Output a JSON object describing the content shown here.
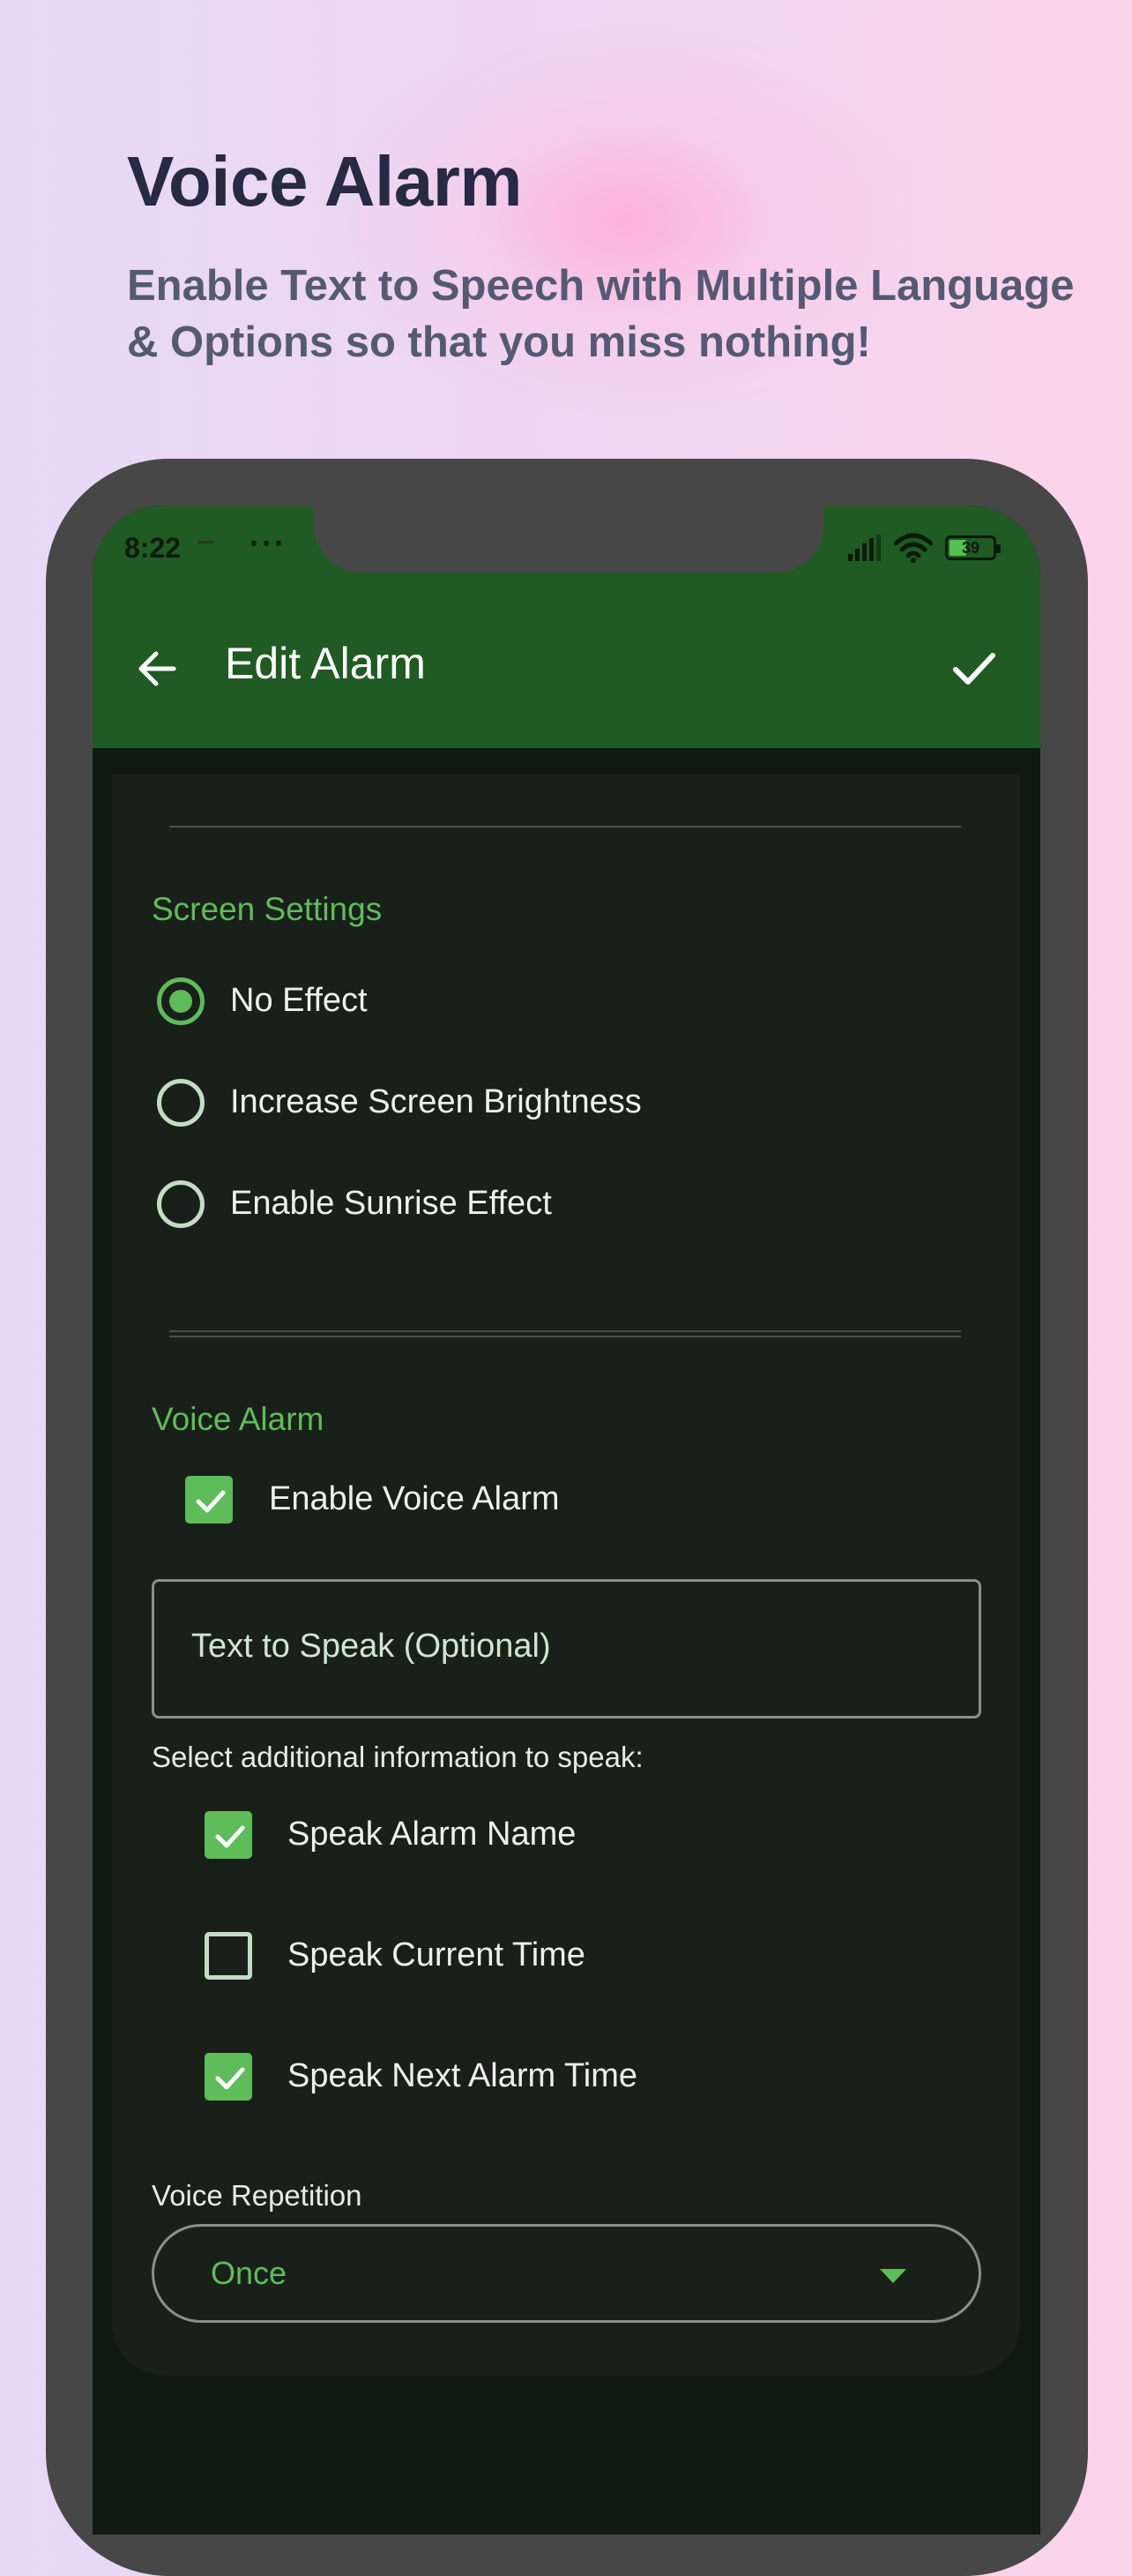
{
  "promo": {
    "title": "Voice Alarm",
    "subtitle": "Enable Text to Speech with Multiple Language & Options so that you miss nothing!"
  },
  "status_bar": {
    "time": "8:22",
    "overflow": "···",
    "battery_level": "39",
    "battery_fraction": 0.39
  },
  "app_bar": {
    "title": "Edit Alarm",
    "back_icon": "arrow-left-icon",
    "confirm_icon": "check-icon"
  },
  "screen_settings": {
    "title": "Screen Settings",
    "options": [
      {
        "label": "No Effect",
        "selected": true
      },
      {
        "label": "Increase Screen Brightness",
        "selected": false
      },
      {
        "label": "Enable Sunrise Effect",
        "selected": false
      }
    ]
  },
  "voice_alarm": {
    "title": "Voice Alarm",
    "enable_label": "Enable Voice Alarm",
    "enable_checked": true,
    "text_placeholder": "Text to Speak (Optional)",
    "additional_label": "Select additional information to speak:",
    "additional": [
      {
        "label": "Speak Alarm Name",
        "checked": true
      },
      {
        "label": "Speak Current Time",
        "checked": false
      },
      {
        "label": "Speak Next Alarm Time",
        "checked": true
      }
    ],
    "repetition_label": "Voice Repetition",
    "repetition_value": "Once"
  },
  "colors": {
    "accent": "#5ebc59",
    "app_bar": "#1f5b22",
    "card": "#192019",
    "frame": "#474747"
  }
}
